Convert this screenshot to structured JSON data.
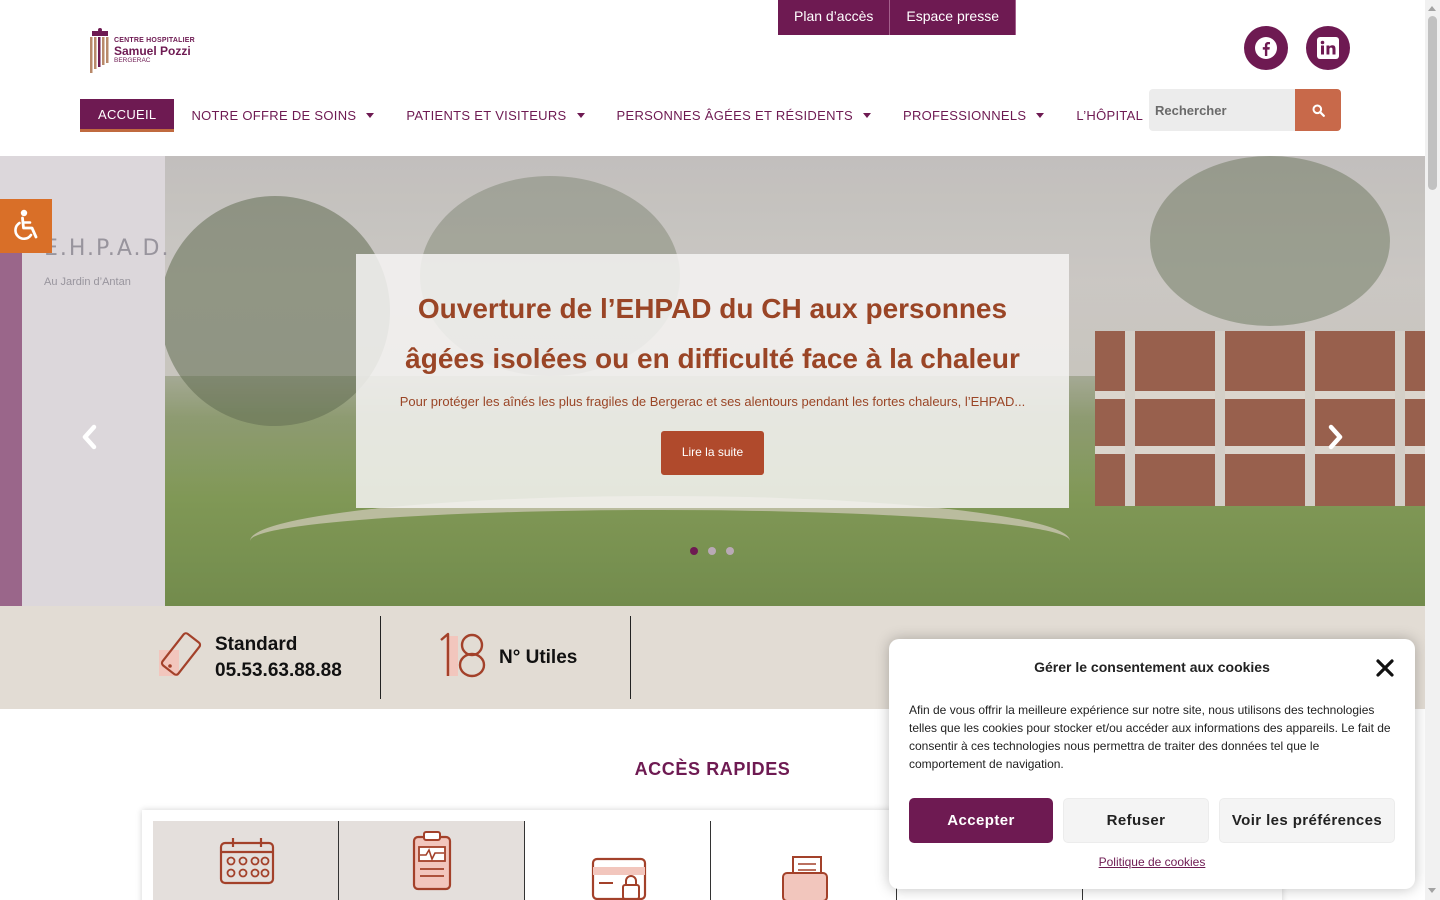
{
  "topbar": {
    "plan_acces": "Plan d’accès",
    "espace_presse": "Espace presse"
  },
  "logo": {
    "line1": "CENTRE HOSPITALIER",
    "line2": "Samuel Pozzi",
    "line3": "BERGERAC"
  },
  "social": {
    "facebook": "facebook-icon",
    "linkedin": "linkedin-icon"
  },
  "nav": {
    "items": [
      {
        "label": "ACCUEIL",
        "active": true
      },
      {
        "label": "NOTRE OFFRE DE SOINS"
      },
      {
        "label": "PATIENTS ET VISITEURS"
      },
      {
        "label": "PERSONNES ÂGÉES ET RÉSIDENTS"
      },
      {
        "label": "PROFESSIONNELS"
      },
      {
        "label": "L’HÔPITAL"
      }
    ]
  },
  "search": {
    "placeholder": "Rechercher"
  },
  "hero": {
    "title": "Ouverture de l’EHPAD du CH aux personnes âgées isolées ou en difficulté face à la chaleur",
    "excerpt": "Pour protéger les aînés les plus fragiles de Bergerac et ses alentours pendant les fortes chaleurs, l’EHPAD...",
    "button": "Lire la suite",
    "current_slide": 1,
    "slide_count": 3
  },
  "info": {
    "standard_label": "Standard",
    "standard_phone": "05.53.63.88.88",
    "numeros_label": "N° Utiles"
  },
  "quick_access": {
    "title": "ACCÈS RAPIDES"
  },
  "cookie": {
    "title": "Gérer le consentement aux cookies",
    "text": "Afin de vous offrir la meilleure expérience sur notre site, nous utilisons des technologies telles que les cookies pour stocker et/ou accéder aux informations des appareils. Le fait de consentir à ces technologies nous permettra de traiter des données tel que le comportement de navigation.",
    "accept": "Accepter",
    "refuse": "Refuser",
    "preferences": "Voir les préférences",
    "policy_link": "Politique de cookies"
  },
  "colors": {
    "brand": "#6e1a52",
    "accent": "#c8694a",
    "a11y": "#d96f28"
  }
}
